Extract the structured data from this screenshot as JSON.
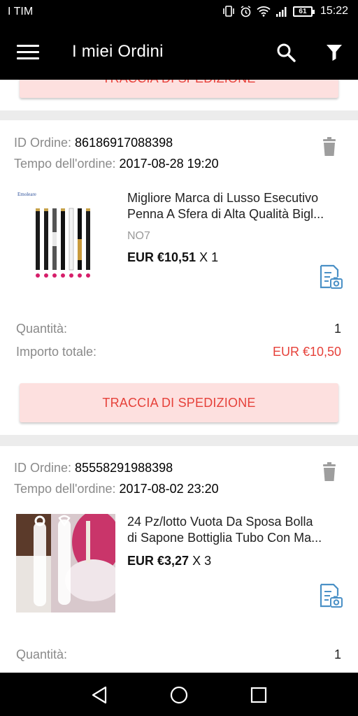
{
  "status_bar": {
    "carrier": "I TIM",
    "battery": "61",
    "time": "15:22"
  },
  "app_bar": {
    "title": "I miei Ordini",
    "icons": [
      "menu-icon",
      "search-icon",
      "filter-icon"
    ]
  },
  "colors": {
    "accent": "#e6413a",
    "button_bg": "#fde0df",
    "icon_blue": "#4a90c6"
  },
  "track_label": "TRACCIA DI SPEDIZIONE",
  "orders": [
    {
      "id_label": "ID Ordine:",
      "id": "86186917088398",
      "time_label": "Tempo dell'ordine:",
      "time": "2017-08-28 19:20",
      "product_title_1": "Migliore Marca di Lusso Esecutivo",
      "product_title_2": "Penna A Sfera di Alta Qualità Bigl...",
      "variant": "NO7",
      "price": "EUR €10,51",
      "qty_text": "X 1",
      "quantity_label": "Quantità:",
      "quantity": "1",
      "total_label": "Importo totale:",
      "total": "EUR €10,50"
    },
    {
      "id_label": "ID Ordine:",
      "id": "85558291988398",
      "time_label": "Tempo dell'ordine:",
      "time": "2017-08-02 23:20",
      "product_title_1": "24 Pz/lotto Vuota Da Sposa Bolla",
      "product_title_2": "di Sapone Bottiglia Tubo Con Ma...",
      "price": "EUR €3,27",
      "qty_text": "X 3",
      "quantity_label": "Quantità:",
      "quantity": "1"
    }
  ],
  "nav_bar": {
    "icons": [
      "back-icon",
      "home-icon",
      "recents-icon"
    ]
  }
}
